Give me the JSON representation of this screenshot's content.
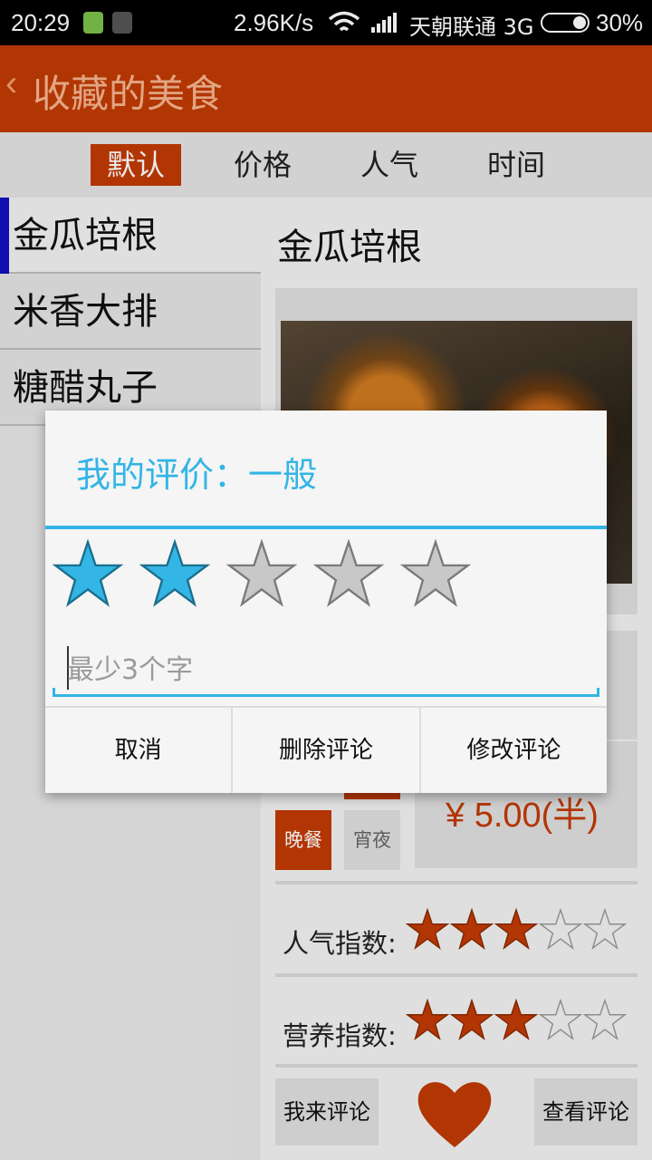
{
  "status_bar": {
    "time": "20:29",
    "net_speed": "2.96K/s",
    "carrier": "天朝联通 3G",
    "battery": "30%"
  },
  "header": {
    "back_glyph": "‹",
    "title": "收藏的美食"
  },
  "sort_tabs": [
    {
      "label": "默认",
      "active": true
    },
    {
      "label": "价格",
      "active": false
    },
    {
      "label": "人气",
      "active": false
    },
    {
      "label": "时间",
      "active": false
    }
  ],
  "food_list": [
    {
      "name": "金瓜培根",
      "selected": true
    },
    {
      "name": "米香大排",
      "selected": false
    },
    {
      "name": "糖醋丸子",
      "selected": false
    }
  ],
  "detail": {
    "name": "金瓜培根",
    "price": "¥ 5.00(半)",
    "meal_tags": [
      {
        "label": "晚餐",
        "active": true
      },
      {
        "label": "宵夜",
        "active": false
      }
    ],
    "popularity": {
      "label": "人气指数:",
      "rating": 3,
      "max": 5
    },
    "nutrition": {
      "label": "营养指数:",
      "rating": 3,
      "max": 5
    },
    "comment_button": "我来评论",
    "view_comments_button": "查看评论",
    "favorite_icon": "heart-icon"
  },
  "dialog": {
    "title": "我的评价：一般",
    "rating": 2,
    "max_rating": 5,
    "input_placeholder": "最少3个字",
    "input_value": "",
    "buttons": {
      "cancel": "取消",
      "delete": "删除评论",
      "modify": "修改评论"
    }
  },
  "colors": {
    "accent": "#c23a05",
    "dialog_blue": "#33b5e5",
    "star_on_dialog": "#33b5e5",
    "star_off": "#c8c8c8",
    "star_on_detail": "#c23a05"
  }
}
